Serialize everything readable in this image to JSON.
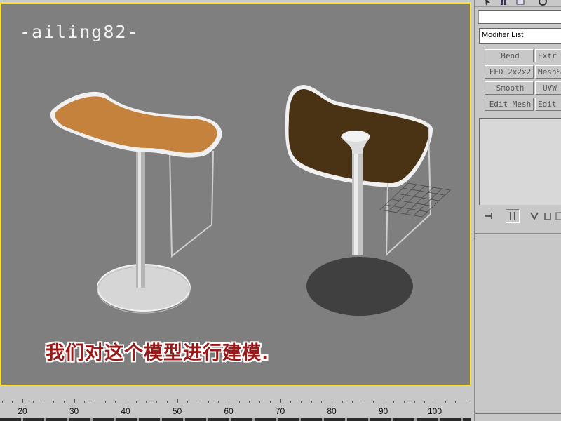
{
  "viewport": {
    "watermark": "-ailing82-",
    "subtitle": "我们对这个模型进行建模."
  },
  "colors": {
    "viewport_border": "#ffe418",
    "viewport_bg": "#7f7f7f",
    "seat_left": "#c4823c",
    "seat_right": "#4a3315",
    "base_left": "#d6d6d6",
    "base_right": "#404040",
    "subtitle_text": "#9a1a1a"
  },
  "timeline": {
    "ticks": [
      "20",
      "30",
      "40",
      "50",
      "60",
      "70",
      "80",
      "90",
      "100"
    ]
  },
  "command_panel": {
    "tab_icons": [
      "arrow-icon",
      "hierarchy-icon",
      "display-icon",
      "utility-icon"
    ],
    "name_field": "",
    "modifier_list_label": "Modifier List",
    "modifier_buttons": [
      [
        "Bend",
        "Extr"
      ],
      [
        "FFD 2x2x2",
        "MeshS"
      ],
      [
        "Smooth",
        "UVW"
      ],
      [
        "Edit Mesh",
        "Edit "
      ]
    ],
    "stack_tools": [
      "pin-stack-icon",
      "show-end-result-icon",
      "make-unique-icon",
      "remove-modifier-icon",
      "configure-icon"
    ]
  }
}
